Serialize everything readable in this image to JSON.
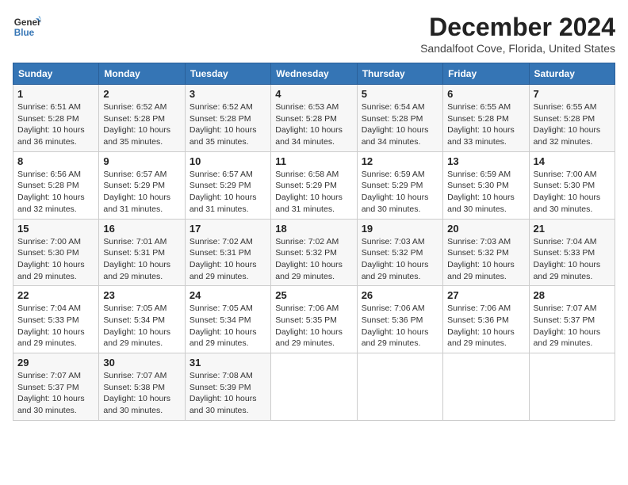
{
  "header": {
    "logo_line1": "General",
    "logo_line2": "Blue",
    "month_title": "December 2024",
    "location": "Sandalfoot Cove, Florida, United States"
  },
  "days_of_week": [
    "Sunday",
    "Monday",
    "Tuesday",
    "Wednesday",
    "Thursday",
    "Friday",
    "Saturday"
  ],
  "weeks": [
    [
      {
        "day": "1",
        "sunrise": "6:51 AM",
        "sunset": "5:28 PM",
        "daylight": "10 hours and 36 minutes"
      },
      {
        "day": "2",
        "sunrise": "6:52 AM",
        "sunset": "5:28 PM",
        "daylight": "10 hours and 35 minutes"
      },
      {
        "day": "3",
        "sunrise": "6:52 AM",
        "sunset": "5:28 PM",
        "daylight": "10 hours and 35 minutes"
      },
      {
        "day": "4",
        "sunrise": "6:53 AM",
        "sunset": "5:28 PM",
        "daylight": "10 hours and 34 minutes"
      },
      {
        "day": "5",
        "sunrise": "6:54 AM",
        "sunset": "5:28 PM",
        "daylight": "10 hours and 34 minutes"
      },
      {
        "day": "6",
        "sunrise": "6:55 AM",
        "sunset": "5:28 PM",
        "daylight": "10 hours and 33 minutes"
      },
      {
        "day": "7",
        "sunrise": "6:55 AM",
        "sunset": "5:28 PM",
        "daylight": "10 hours and 32 minutes"
      }
    ],
    [
      {
        "day": "8",
        "sunrise": "6:56 AM",
        "sunset": "5:28 PM",
        "daylight": "10 hours and 32 minutes"
      },
      {
        "day": "9",
        "sunrise": "6:57 AM",
        "sunset": "5:29 PM",
        "daylight": "10 hours and 31 minutes"
      },
      {
        "day": "10",
        "sunrise": "6:57 AM",
        "sunset": "5:29 PM",
        "daylight": "10 hours and 31 minutes"
      },
      {
        "day": "11",
        "sunrise": "6:58 AM",
        "sunset": "5:29 PM",
        "daylight": "10 hours and 31 minutes"
      },
      {
        "day": "12",
        "sunrise": "6:59 AM",
        "sunset": "5:29 PM",
        "daylight": "10 hours and 30 minutes"
      },
      {
        "day": "13",
        "sunrise": "6:59 AM",
        "sunset": "5:30 PM",
        "daylight": "10 hours and 30 minutes"
      },
      {
        "day": "14",
        "sunrise": "7:00 AM",
        "sunset": "5:30 PM",
        "daylight": "10 hours and 30 minutes"
      }
    ],
    [
      {
        "day": "15",
        "sunrise": "7:00 AM",
        "sunset": "5:30 PM",
        "daylight": "10 hours and 29 minutes"
      },
      {
        "day": "16",
        "sunrise": "7:01 AM",
        "sunset": "5:31 PM",
        "daylight": "10 hours and 29 minutes"
      },
      {
        "day": "17",
        "sunrise": "7:02 AM",
        "sunset": "5:31 PM",
        "daylight": "10 hours and 29 minutes"
      },
      {
        "day": "18",
        "sunrise": "7:02 AM",
        "sunset": "5:32 PM",
        "daylight": "10 hours and 29 minutes"
      },
      {
        "day": "19",
        "sunrise": "7:03 AM",
        "sunset": "5:32 PM",
        "daylight": "10 hours and 29 minutes"
      },
      {
        "day": "20",
        "sunrise": "7:03 AM",
        "sunset": "5:32 PM",
        "daylight": "10 hours and 29 minutes"
      },
      {
        "day": "21",
        "sunrise": "7:04 AM",
        "sunset": "5:33 PM",
        "daylight": "10 hours and 29 minutes"
      }
    ],
    [
      {
        "day": "22",
        "sunrise": "7:04 AM",
        "sunset": "5:33 PM",
        "daylight": "10 hours and 29 minutes"
      },
      {
        "day": "23",
        "sunrise": "7:05 AM",
        "sunset": "5:34 PM",
        "daylight": "10 hours and 29 minutes"
      },
      {
        "day": "24",
        "sunrise": "7:05 AM",
        "sunset": "5:34 PM",
        "daylight": "10 hours and 29 minutes"
      },
      {
        "day": "25",
        "sunrise": "7:06 AM",
        "sunset": "5:35 PM",
        "daylight": "10 hours and 29 minutes"
      },
      {
        "day": "26",
        "sunrise": "7:06 AM",
        "sunset": "5:36 PM",
        "daylight": "10 hours and 29 minutes"
      },
      {
        "day": "27",
        "sunrise": "7:06 AM",
        "sunset": "5:36 PM",
        "daylight": "10 hours and 29 minutes"
      },
      {
        "day": "28",
        "sunrise": "7:07 AM",
        "sunset": "5:37 PM",
        "daylight": "10 hours and 29 minutes"
      }
    ],
    [
      {
        "day": "29",
        "sunrise": "7:07 AM",
        "sunset": "5:37 PM",
        "daylight": "10 hours and 30 minutes"
      },
      {
        "day": "30",
        "sunrise": "7:07 AM",
        "sunset": "5:38 PM",
        "daylight": "10 hours and 30 minutes"
      },
      {
        "day": "31",
        "sunrise": "7:08 AM",
        "sunset": "5:39 PM",
        "daylight": "10 hours and 30 minutes"
      },
      null,
      null,
      null,
      null
    ]
  ]
}
